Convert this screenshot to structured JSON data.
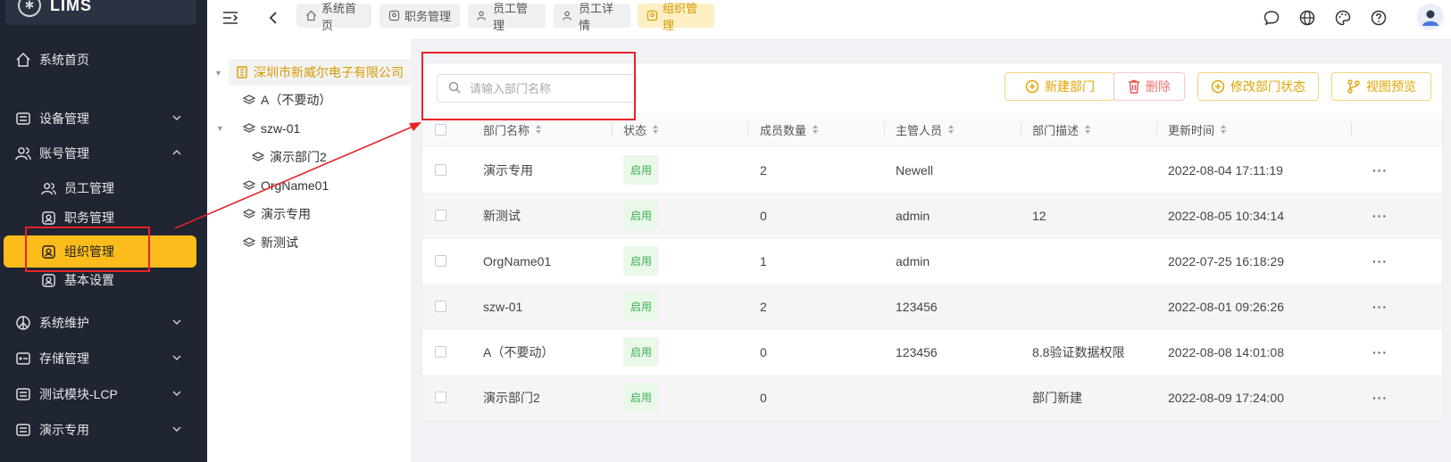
{
  "app": {
    "logo_text": "LIMS"
  },
  "sidebar": {
    "items": [
      {
        "label": "系统首页"
      },
      {
        "label": "设备管理"
      },
      {
        "label": "账号管理"
      },
      {
        "label": "员工管理"
      },
      {
        "label": "职务管理"
      },
      {
        "label": "组织管理"
      },
      {
        "label": "基本设置"
      },
      {
        "label": "系统维护"
      },
      {
        "label": "存储管理"
      },
      {
        "label": "测试模块-LCP"
      },
      {
        "label": "演示专用"
      }
    ]
  },
  "tabs": [
    {
      "label": "系统首页"
    },
    {
      "label": "职务管理"
    },
    {
      "label": "员工管理"
    },
    {
      "label": "员工详情"
    },
    {
      "label": "组织管理"
    }
  ],
  "tree": {
    "root": "深圳市新威尔电子有限公司",
    "nodes": [
      {
        "label": "A（不要动）"
      },
      {
        "label": "szw-01"
      },
      {
        "label": "演示部门2"
      },
      {
        "label": "OrgName01"
      },
      {
        "label": "演示专用"
      },
      {
        "label": "新测试"
      }
    ]
  },
  "search": {
    "placeholder": "请输入部门名称"
  },
  "toolbar": {
    "new_label": "新建部门",
    "delete_label": "删除",
    "status_label": "修改部门状态",
    "preview_label": "视图预览"
  },
  "table": {
    "columns": [
      "部门名称",
      "状态",
      "成员数量",
      "主管人员",
      "部门描述",
      "更新时间"
    ],
    "rows": [
      {
        "name": "演示专用",
        "status": "启用",
        "members": "2",
        "manager": "Newell",
        "desc": "",
        "updated": "2022-08-04 17:11:19"
      },
      {
        "name": "新测试",
        "status": "启用",
        "members": "0",
        "manager": "admin",
        "desc": "12",
        "updated": "2022-08-05 10:34:14"
      },
      {
        "name": "OrgName01",
        "status": "启用",
        "members": "1",
        "manager": "admin",
        "desc": "",
        "updated": "2022-07-25 16:18:29"
      },
      {
        "name": "szw-01",
        "status": "启用",
        "members": "2",
        "manager": "123456",
        "desc": "",
        "updated": "2022-08-01 09:26:26"
      },
      {
        "name": "A（不要动）",
        "status": "启用",
        "members": "0",
        "manager": "123456",
        "desc": "8.8验证数据权限",
        "updated": "2022-08-08 14:01:08"
      },
      {
        "name": "演示部门2",
        "status": "启用",
        "members": "0",
        "manager": "",
        "desc": "部门新建",
        "updated": "2022-08-09 17:24:00"
      }
    ],
    "more_label": "···"
  },
  "colors": {
    "accent": "#fcbd1c",
    "sidebar_bg": "#1f2532",
    "annotation": "#e8232a",
    "status_green": "#3cb050"
  }
}
